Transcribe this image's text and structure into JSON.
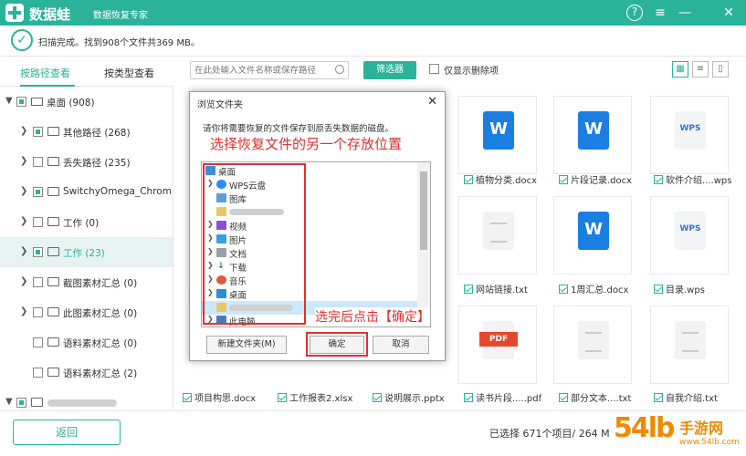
{
  "app": {
    "brand": "数据蛙",
    "subtitle": "数据恢复专家",
    "help_glyph": "?",
    "menu_glyph": "≡",
    "min_glyph": "—",
    "close_glyph": "✕"
  },
  "status": {
    "check_glyph": "✓",
    "text": "扫描完成。找到908个文件共369 MB。"
  },
  "tabs": {
    "by_path": "按路径查看",
    "by_type": "按类型查看"
  },
  "toolbar": {
    "search_placeholder": "在此处输入文件名称或保存路径",
    "filter_label": "筛选器",
    "only_deleted_label": "仅显示删除项",
    "view_grid": "▦",
    "view_list": "≡",
    "view_detail": "▯"
  },
  "tree": [
    {
      "label": "桌面 (908)"
    },
    {
      "label": "其他路径 (268)"
    },
    {
      "label": "丢失路径 (235)"
    },
    {
      "label": "SwitchyOmega_Chromium"
    },
    {
      "label": "工作 (0)"
    },
    {
      "label": "工作 (23)"
    },
    {
      "label": "截图素材汇总 (0)"
    },
    {
      "label": "此图素材汇总 (0)"
    },
    {
      "label": "语料素材汇总 (0)"
    },
    {
      "label": "语料素材汇总 (2)"
    },
    {
      "label": ""
    }
  ],
  "files": {
    "row1": [
      "植物分类.docx",
      "片段记录.docx",
      "软件介绍....wps"
    ],
    "row2": [
      "网站链接.txt",
      "1周汇总.docx",
      "目录.wps"
    ],
    "row3": [
      "项目构思.docx",
      "工作报表2.xlsx",
      "说明展示.pptx",
      "读书片段.....pdf",
      "部分文本....txt",
      "自我介绍.txt"
    ],
    "icons": {
      "word": "word-icon",
      "wps": "wps-icon",
      "txt": "txt-icon",
      "pdf": "pdf-icon"
    }
  },
  "footer": {
    "back_label": "返回",
    "selected_text": "已选择 671个项目/ 264 M"
  },
  "watermark": {
    "number": "54lb",
    "text": "手游网",
    "url": "www.54lb.com"
  },
  "dialog": {
    "title": "浏览文件夹",
    "close_glyph": "✕",
    "description": "请你将需要恢复的文件保存到原丢失数据的磁盘。",
    "annotation_top": "选择恢复文件的另一个存放位置",
    "annotation_bottom": "选完后点击【确定】",
    "folders": [
      "桌面",
      "WPS云盘",
      "图库",
      "",
      "视频",
      "图片",
      "文档",
      "下载",
      "音乐",
      "桌面",
      "",
      "此电脑"
    ],
    "new_folder_label": "新建文件夹(M)",
    "ok_label": "确定",
    "cancel_label": "取消"
  },
  "colors": {
    "accent": "#2bb39a",
    "annotation": "#e03030",
    "word": "#1a7fe0",
    "pdf": "#e4482c"
  }
}
